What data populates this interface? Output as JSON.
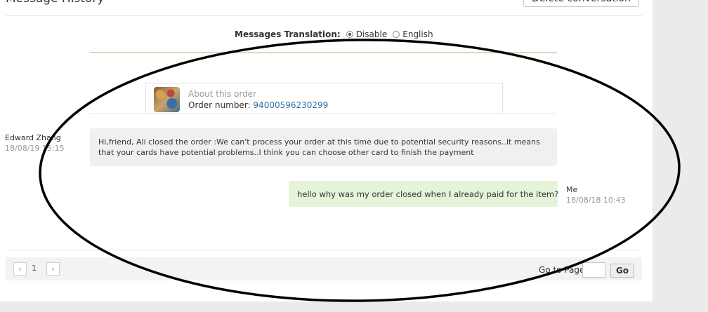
{
  "header": {
    "title": "Message History",
    "delete_button": "Delete conversation"
  },
  "translation": {
    "label": "Messages Translation:",
    "options": [
      {
        "label": "Disable",
        "selected": true
      },
      {
        "label": "English",
        "selected": false
      }
    ]
  },
  "order": {
    "about": "About this order",
    "number_label": "Order number:",
    "number": "94000596230299"
  },
  "messages": [
    {
      "sender": "Edward Zhang",
      "time": "18/08/19 15:15",
      "text": "Hi,friend, Ali closed the order :We can't process your order at this time due to potential security reasons..it means that your cards have potential problems..I think you can choose other card to finish the payment"
    },
    {
      "sender": "Me",
      "time": "18/08/18 10:43",
      "text": "hello why was my order closed when I already paid for the item?"
    }
  ],
  "pagination": {
    "prev": "‹",
    "current_page": "1",
    "next": "›",
    "goto_label": "Go to Page",
    "go_button": "Go"
  },
  "colors": {
    "incoming_bubble": "#f0f0f0",
    "outgoing_bubble": "#e5f3d9",
    "link": "#2a6fa8",
    "annotation_ellipse": "#000000"
  }
}
